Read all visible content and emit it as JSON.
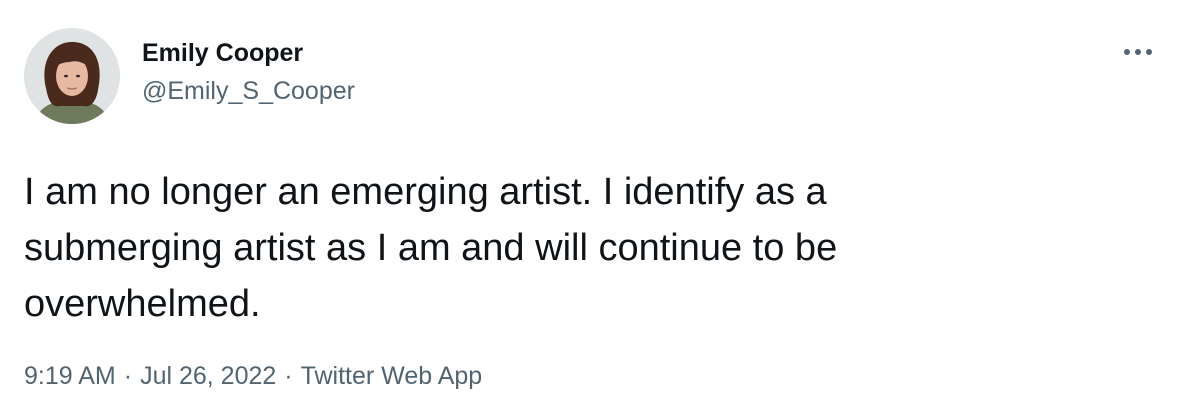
{
  "author": {
    "display_name": "Emily Cooper",
    "handle": "@Emily_S_Cooper",
    "avatar_icon": "profile-photo"
  },
  "more_menu_icon": "more-horizontal-icon",
  "tweet": {
    "text": "I am no longer an emerging artist. I identify as a\nsubmerging artist as I am and will continue to be\noverwhelmed."
  },
  "meta": {
    "time": "9:19 AM",
    "date": "Jul 26, 2022",
    "source": "Twitter Web App",
    "separator": "·"
  },
  "colors": {
    "text_primary": "#0f1419",
    "text_secondary": "#536471",
    "background": "#ffffff"
  }
}
